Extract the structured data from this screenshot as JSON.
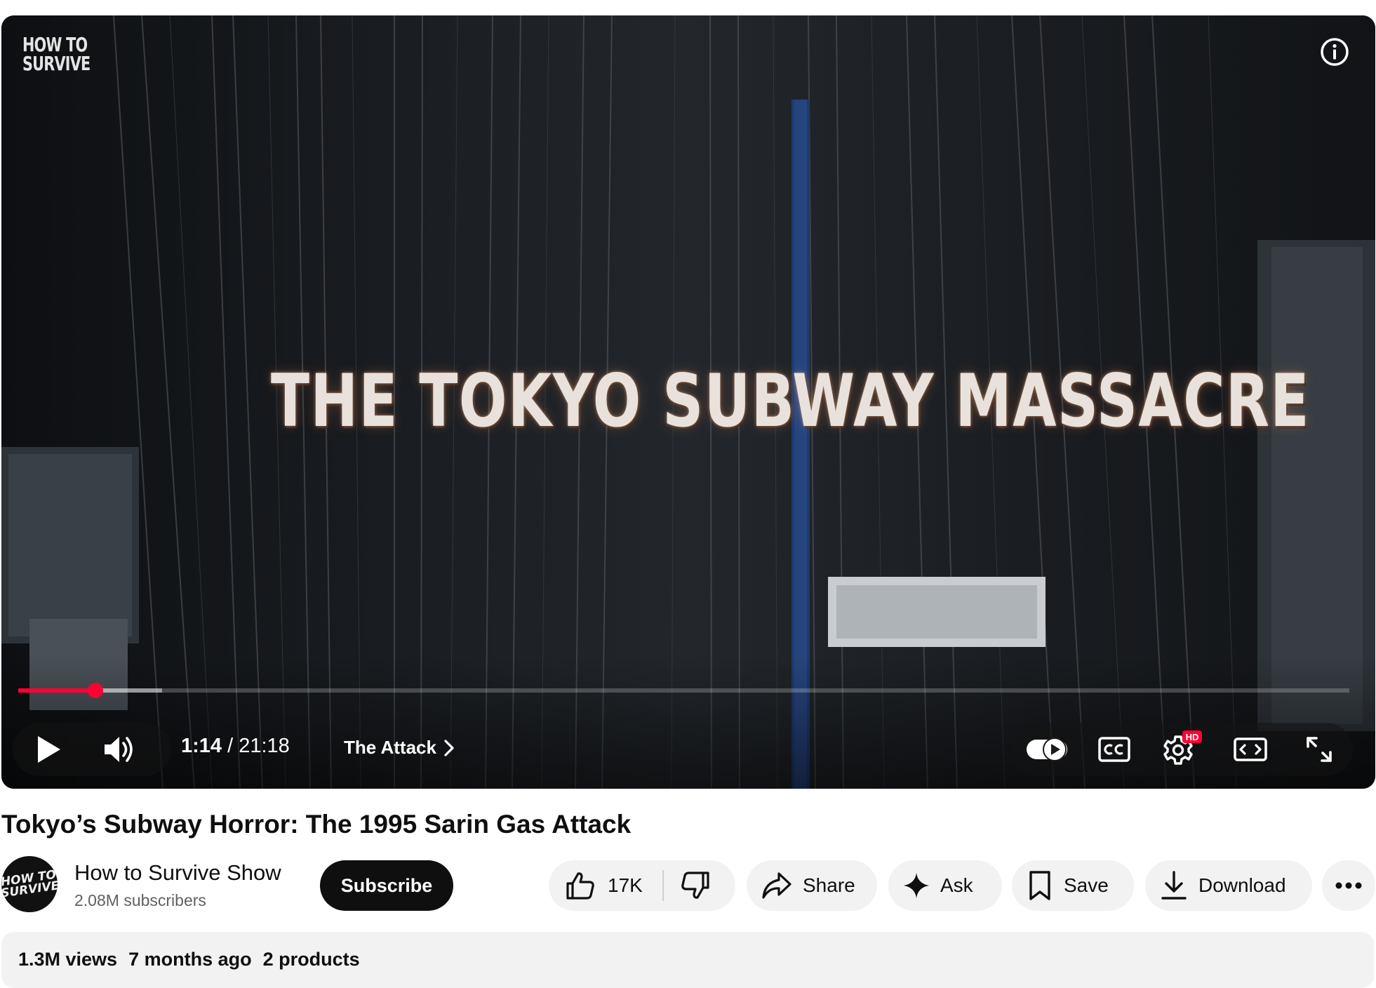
{
  "player": {
    "watermark_line1": "HOW TO",
    "watermark_line2": "SURVIVE",
    "title_card": "THE TOKYO SUBWAY MASSACRE",
    "current_time": "1:14",
    "time_separator": " / ",
    "duration": "21:18",
    "chapter": "The Attack",
    "played_fraction": 0.058,
    "buffered_fraction": 0.108,
    "icons": {
      "info": "info-icon",
      "play": "play-icon",
      "volume": "volume-icon",
      "chapter_next": "chevron-right-icon",
      "autoplay": "autoplay-toggle-icon",
      "captions": "closed-captions-icon",
      "settings": "settings-gear-icon",
      "settings_badge": "HD",
      "theater": "theater-mode-icon",
      "fullscreen": "fullscreen-icon"
    },
    "accent_color": "#ff0033"
  },
  "video": {
    "title": "Tokyo’s Subway Horror: The 1995 Sarin Gas Attack"
  },
  "channel": {
    "name": "How to Survive Show",
    "subscribers": "2.08M subscribers",
    "avatar_text": "HOW TO SURVIVE",
    "subscribe_label": "Subscribe"
  },
  "actions": {
    "likes": "17K",
    "share": "Share",
    "ask": "Ask",
    "save": "Save",
    "download": "Download"
  },
  "description": {
    "views": "1.3M views",
    "age": "7 months ago",
    "products": "2 products"
  }
}
